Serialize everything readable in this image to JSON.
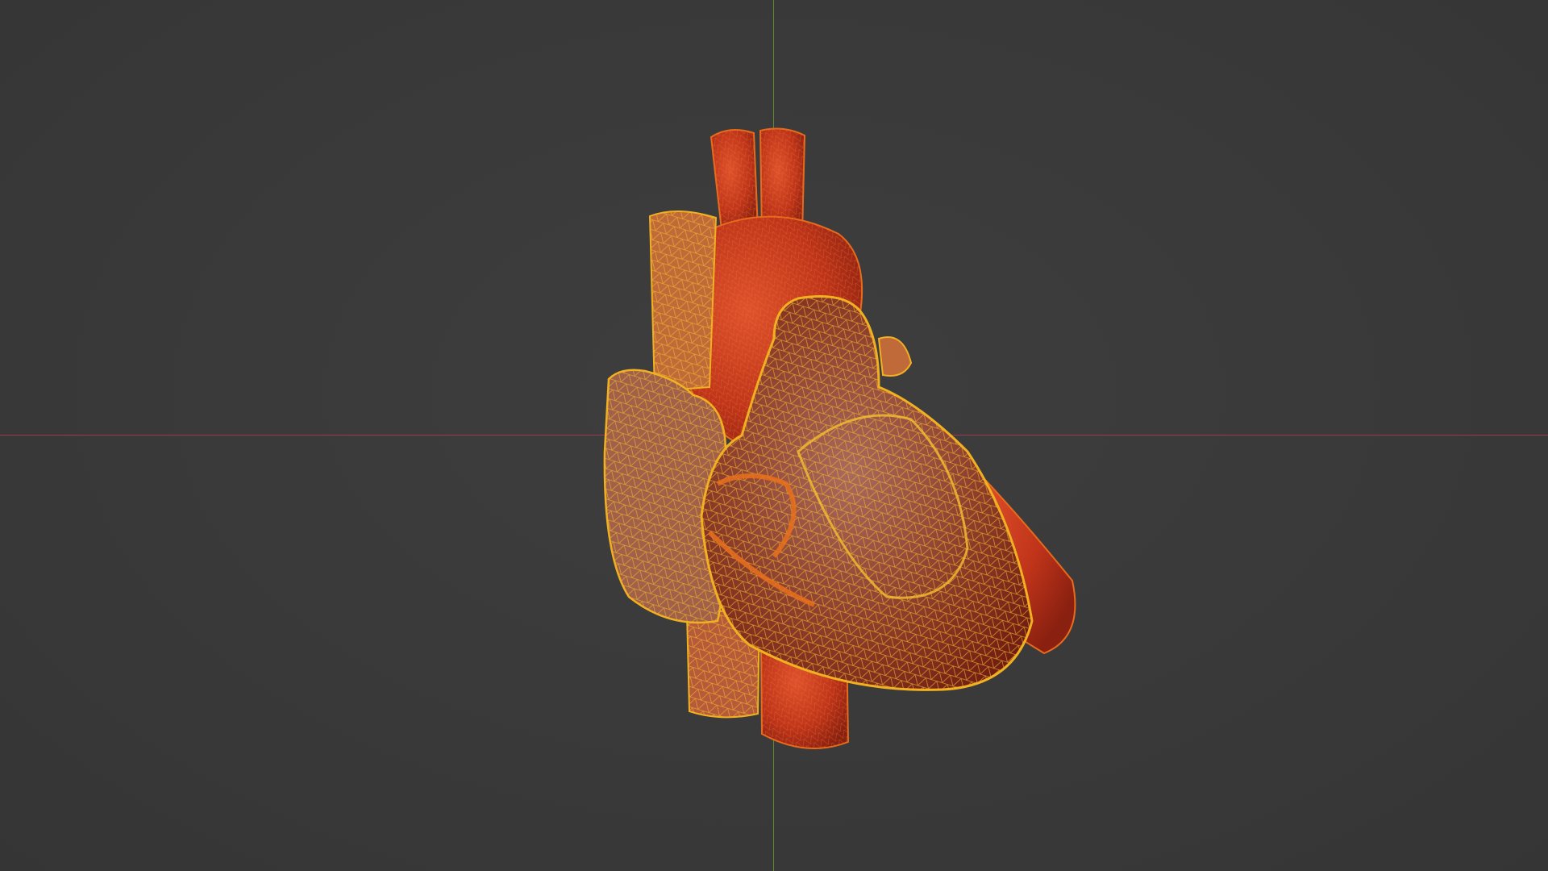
{
  "viewport": {
    "object": "heart-model",
    "display_mode": "wireframe-overlay",
    "colors": {
      "background": "#3a3a3a",
      "x_axis": "#9a3a4c",
      "y_axis": "#5f8a2c",
      "mesh_fill": "#c0341a",
      "wire_selected": "#f0b020"
    }
  }
}
